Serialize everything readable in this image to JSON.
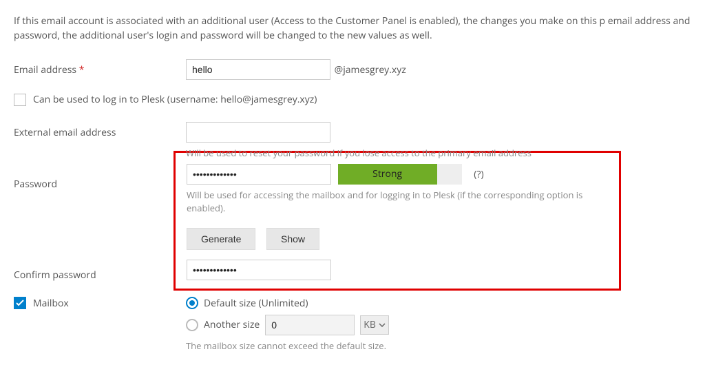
{
  "intro": "If this email account is associated with an additional user (Access to the Customer Panel is enabled), the changes you make on this p email address and password, the additional user's login and password will be changed to the new values as well.",
  "email": {
    "label": "Email address",
    "value": "hello",
    "domain": "@jamesgrey.xyz"
  },
  "login_checkbox": {
    "label": "Can be used to log in to Plesk  (username: hello@jamesgrey.xyz)",
    "checked": false
  },
  "external": {
    "label": "External email address",
    "value": "",
    "hint": "Will be used to reset your password if you lose access to the primary email address"
  },
  "password": {
    "label": "Password",
    "value": "•••••••••••••",
    "strength_label": "Strong",
    "help": "(?)",
    "hint": "Will be used for accessing the mailbox and for logging in to Plesk (if the corresponding option is enabled).",
    "generate": "Generate",
    "show": "Show"
  },
  "confirm": {
    "label": "Confirm password",
    "value": "•••••••••••••"
  },
  "mailbox": {
    "label": "Mailbox",
    "checked": true,
    "default_label": "Default size (Unlimited)",
    "another_label": "Another size",
    "another_value": "0",
    "unit": "KB",
    "hint": "The mailbox size cannot exceed the default size."
  }
}
